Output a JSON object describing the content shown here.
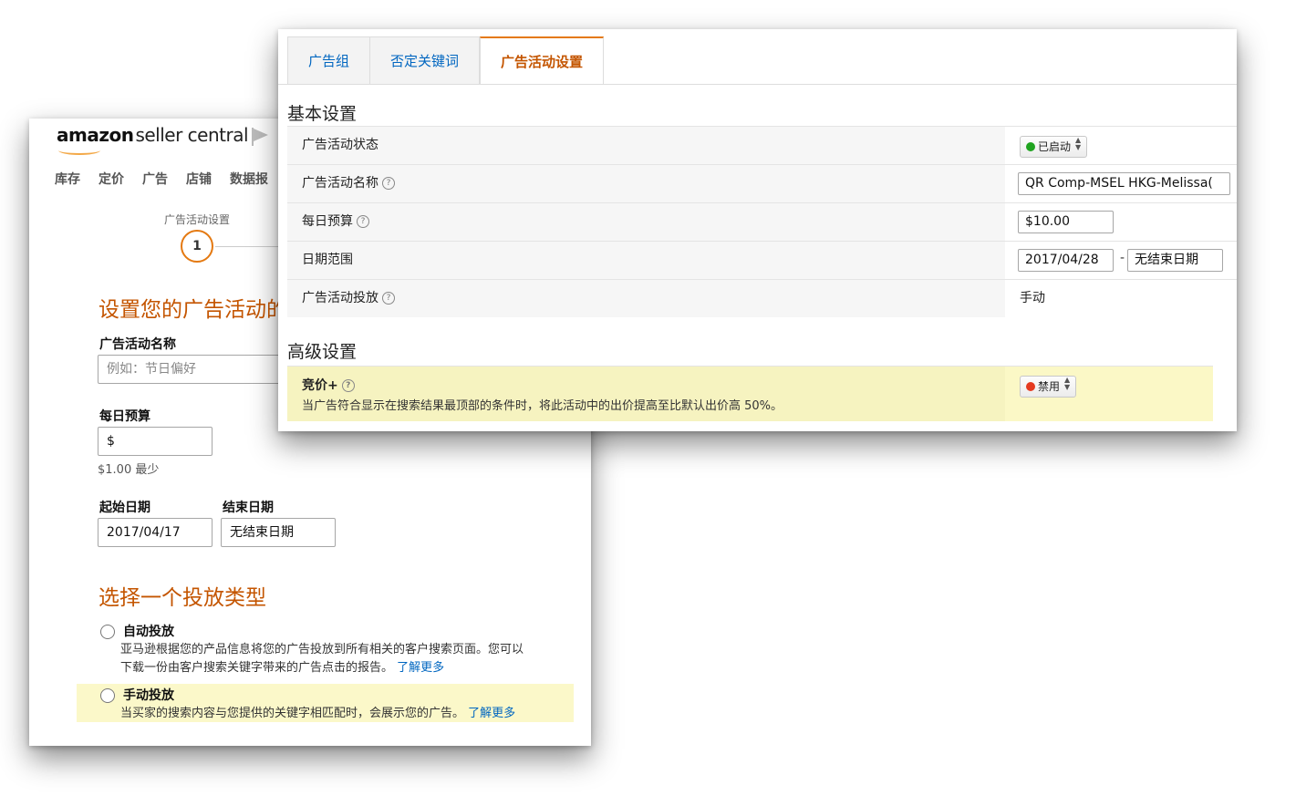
{
  "back_panel": {
    "logo": {
      "brand": "amazon",
      "product": "seller central"
    },
    "nav": [
      "库存",
      "定价",
      "广告",
      "店铺",
      "数据报"
    ],
    "step": {
      "label": "广告活动设置",
      "number": "1"
    },
    "heading": "设置您的广告活动的",
    "campaign_name": {
      "label": "广告活动名称",
      "placeholder": "例如：节日偏好"
    },
    "daily_budget": {
      "label": "每日预算",
      "value": "$",
      "hint": "$1.00 最少"
    },
    "start_date": {
      "label": "起始日期",
      "value": "2017/04/17"
    },
    "end_date": {
      "label": "结束日期",
      "value": "无结束日期"
    },
    "targeting_heading": "选择一个投放类型",
    "auto": {
      "title": "自动投放",
      "desc": "亚马逊根据您的产品信息将您的广告投放到所有相关的客户搜索页面。您可以下载一份由客户搜索关键字带来的广告点击的报告。",
      "link": "了解更多"
    },
    "manual": {
      "title": "手动投放",
      "desc": "当买家的搜索内容与您提供的关键字相匹配时，会展示您的广告。",
      "link": "了解更多"
    }
  },
  "front_panel": {
    "tabs": [
      "广告组",
      "否定关键词",
      "广告活动设置"
    ],
    "basic_title": "基本设置",
    "rows": {
      "status": {
        "label": "广告活动状态",
        "value": "已启动",
        "color": "#1fa31f"
      },
      "name": {
        "label": "广告活动名称",
        "value": "QR Comp-MSEL HKG-Melissa("
      },
      "budget": {
        "label": "每日预算",
        "value": "$10.00"
      },
      "dates": {
        "label": "日期范围",
        "start": "2017/04/28",
        "separator": "-",
        "end": "无结束日期"
      },
      "targeting": {
        "label": "广告活动投放",
        "value": "手动"
      }
    },
    "advanced_title": "高级设置",
    "bid_plus": {
      "label": "竞价+",
      "desc": "当广告符合显示在搜索结果最顶部的条件时，将此活动中的出价提高至比默认出价高 50%。",
      "status": "禁用",
      "color": "#e53a20"
    }
  }
}
